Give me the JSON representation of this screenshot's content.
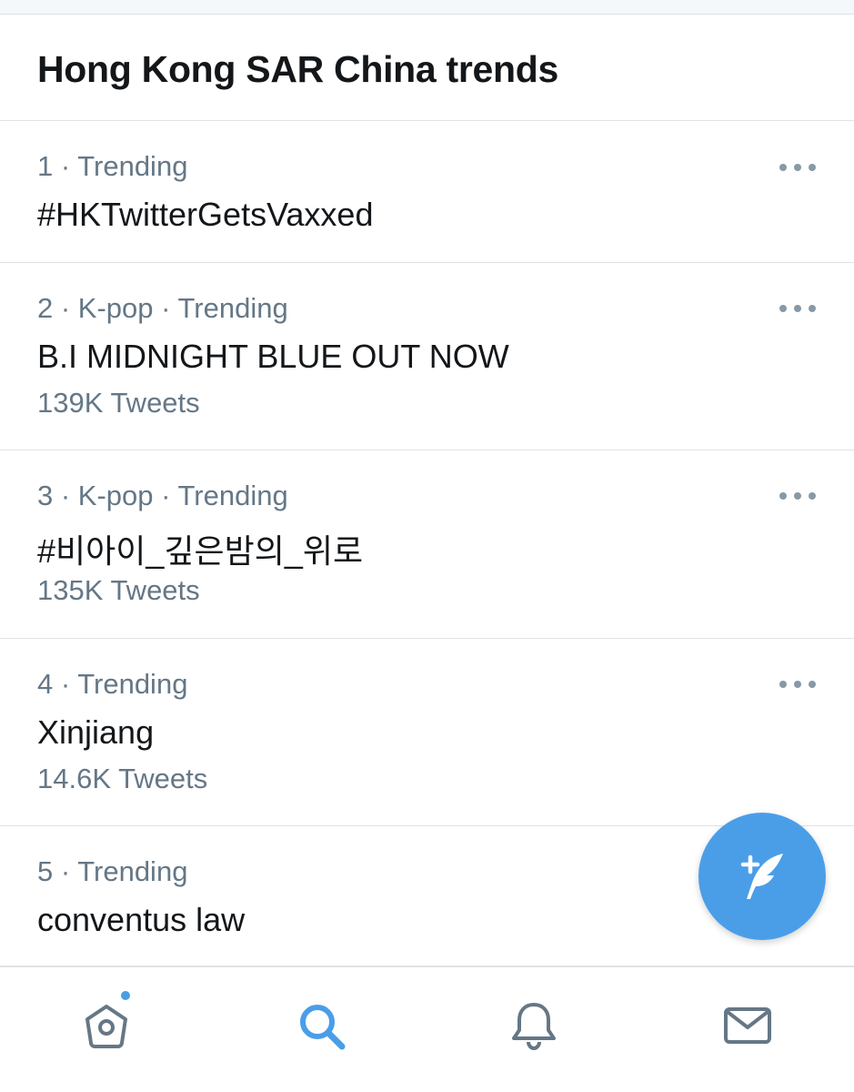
{
  "header": {
    "title": "Hong Kong SAR China trends"
  },
  "trends": [
    {
      "meta": "1 · Trending",
      "name": "#HKTwitterGetsVaxxed",
      "count": ""
    },
    {
      "meta": "2 · K-pop · Trending",
      "name": "B.I MIDNIGHT BLUE OUT NOW",
      "count": "139K Tweets"
    },
    {
      "meta": "3 · K-pop · Trending",
      "name": "#비아이_깊은밤의_위로",
      "count": "135K Tweets"
    },
    {
      "meta": "4 · Trending",
      "name": "Xinjiang",
      "count": "14.6K Tweets"
    },
    {
      "meta": "5 · Trending",
      "name": "conventus law",
      "count": ""
    }
  ],
  "tabbar": {
    "items": [
      {
        "icon": "home-icon",
        "has_notification": true
      },
      {
        "icon": "search-icon",
        "active": true
      },
      {
        "icon": "bell-icon"
      },
      {
        "icon": "mail-icon"
      }
    ]
  },
  "compose": {
    "icon": "feather-plus-icon"
  },
  "colors": {
    "accent": "#4a9ee8",
    "text": "#14171a",
    "secondary_text": "#657786",
    "divider": "#dfe3e6",
    "inactive_icon": "#657786"
  }
}
